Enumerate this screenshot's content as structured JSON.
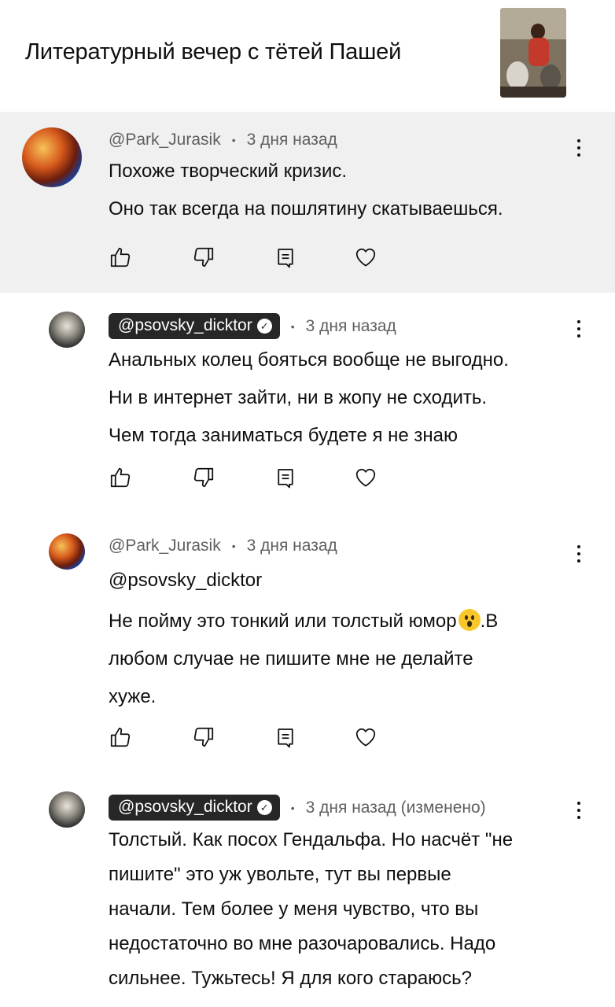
{
  "header": {
    "title": "Литературный вечер с тётей Пашей"
  },
  "comments": [
    {
      "author": "@Park_Jurasik",
      "time": "3 дня назад",
      "lines": [
        "Похоже творческий кризис.",
        "Оно так всегда на пошлятину скатываешься."
      ]
    },
    {
      "author": "@psovsky_dicktor",
      "time": "3 дня назад",
      "lines": [
        "Анальных колец бояться вообще не выгодно.",
        "Ни в интернет зайти, ни в жопу не сходить.",
        "Чем тогда заниматься будете я не знаю"
      ]
    },
    {
      "author": "@Park_Jurasik",
      "time": "3 дня назад",
      "lines": [
        "@psovsky_dicktor",
        "Не пойму это тонкий или толстый юмор",
        ".В",
        "любом случае не пишите мне не делайте",
        "хуже."
      ]
    },
    {
      "author": "@psovsky_dicktor",
      "time": "3 дня назад (изменено)",
      "lines": [
        "Толстый. Как посох Гендальфа. Но насчёт \"не",
        "пишите\" это уж увольте, тут вы первые",
        "начали. Тем более у меня чувство, что вы",
        "недостаточно во мне разочаровались. Надо",
        "сильнее. Тужьтесь! Я для кого стараюсь?"
      ]
    }
  ],
  "icons": {
    "like": "thumbs-up-icon",
    "dislike": "thumbs-down-icon",
    "reply": "reply-icon",
    "heart": "heart-icon",
    "more": "more-vert-icon",
    "verified": "verified-check-icon",
    "emoji": "surprised-face-emoji"
  },
  "colors": {
    "highlight_bg": "#f0f0f0",
    "chip_bg": "#272727",
    "meta_text": "#606060"
  }
}
